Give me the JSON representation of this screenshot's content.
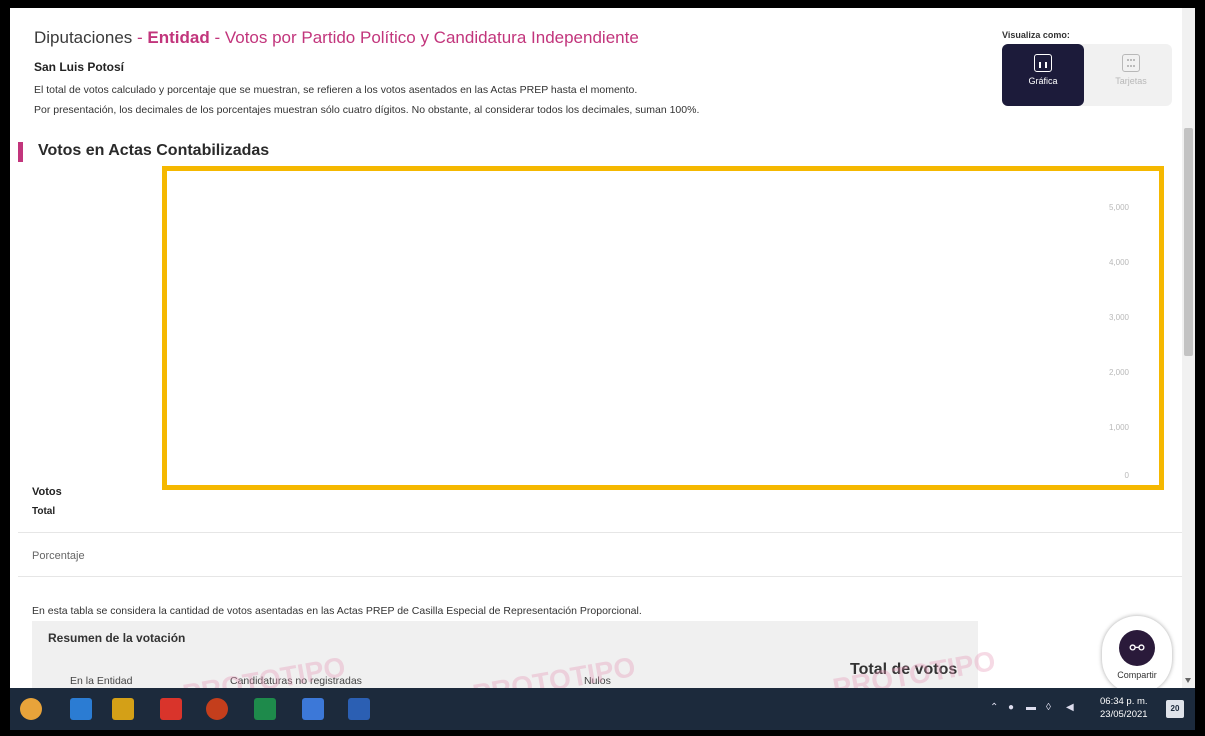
{
  "header": {
    "title_part1": "Diputaciones",
    "title_sep1": " - ",
    "title_entidad": "Entidad",
    "title_sep2": " - ",
    "title_rest": "Votos por Partido Político y Candidatura Independiente",
    "state": "San Luis Potosí",
    "note1": "El total de votos calculado y porcentaje que se muestran, se refieren a los votos asentados en las Actas PREP hasta el momento.",
    "note2": "Por presentación, los decimales de los porcentajes muestran sólo cuatro dígitos. No obstante, al considerar todos los decimales, suman 100%."
  },
  "view_toggle": {
    "label": "Visualiza como:",
    "chart_label": "Gráfica",
    "table_label": "Tarjetas"
  },
  "section": {
    "title": "Votos en Actas Contabilizadas"
  },
  "chart_axis": {
    "ticks": [
      "5,000",
      "4,000",
      "3,000",
      "2,000",
      "1,000",
      "0"
    ]
  },
  "rows": {
    "votos": "Votos",
    "total": "Total",
    "porcentaje": "Porcentaje"
  },
  "table": {
    "note": "En esta tabla se considera la cantidad de votos asentadas en las Actas PREP de Casilla Especial de Representación Proporcional.",
    "summary_title": "Resumen de la votación",
    "col_entidad": "En la Entidad",
    "col_no_registradas": "Candidaturas no registradas",
    "col_nulos": "Nulos",
    "total_votos": "Total de votos"
  },
  "watermark": "PROTOTIPO",
  "share": {
    "label": "Compartir"
  },
  "taskbar": {
    "time": "06:34 p. m.",
    "date": "23/05/2021",
    "notif_count": "20",
    "colors": [
      "#e8a33a",
      "#2b7cd3",
      "#d4a017",
      "#d9342b",
      "#c43e1c",
      "#1e8a4b",
      "#3c78d8",
      "#2b5fb3"
    ]
  }
}
